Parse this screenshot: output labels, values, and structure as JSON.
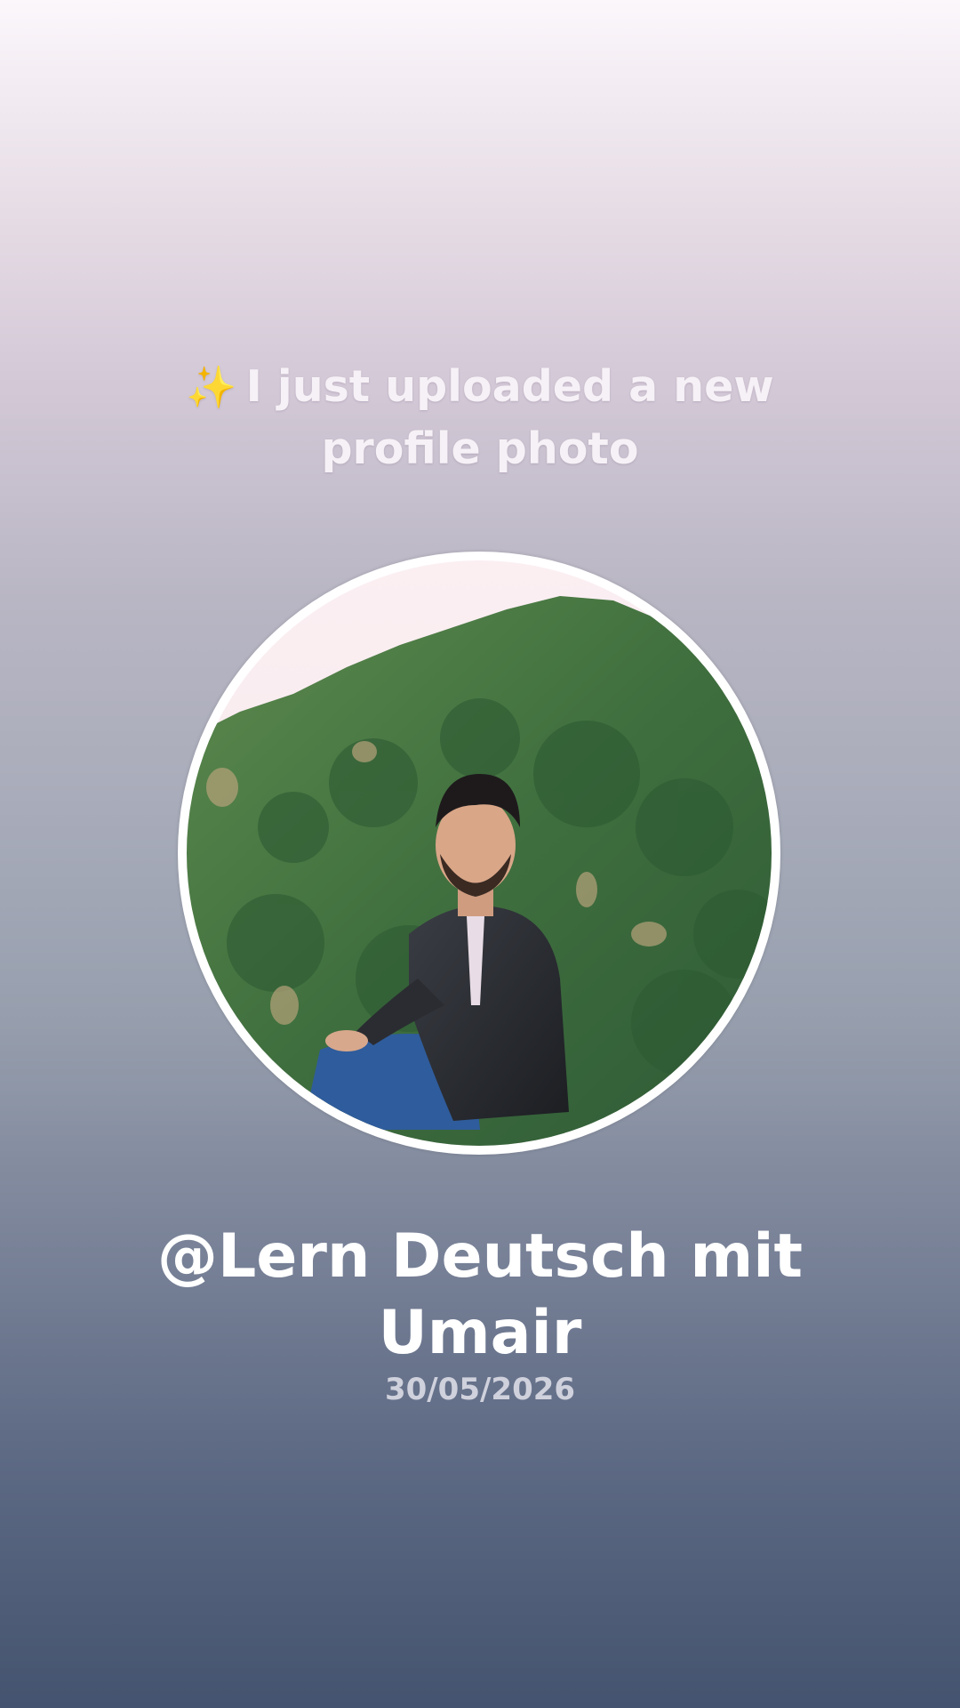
{
  "headline": {
    "icon": "sparkles-icon",
    "sparkle_glyph": "✨",
    "line1": "I just uploaded a new",
    "line2": "profile photo"
  },
  "profile": {
    "photo_label": "profile-photo",
    "username_line1": "@Lern Deutsch mit",
    "username_line2": "Umair",
    "date": "30/05/2026"
  },
  "colors": {
    "background_top": "#fbf7fb",
    "background_bottom": "#44536f",
    "ring": "#ffffff",
    "text": "#ffffff",
    "sparkle": "#f2c94c"
  }
}
